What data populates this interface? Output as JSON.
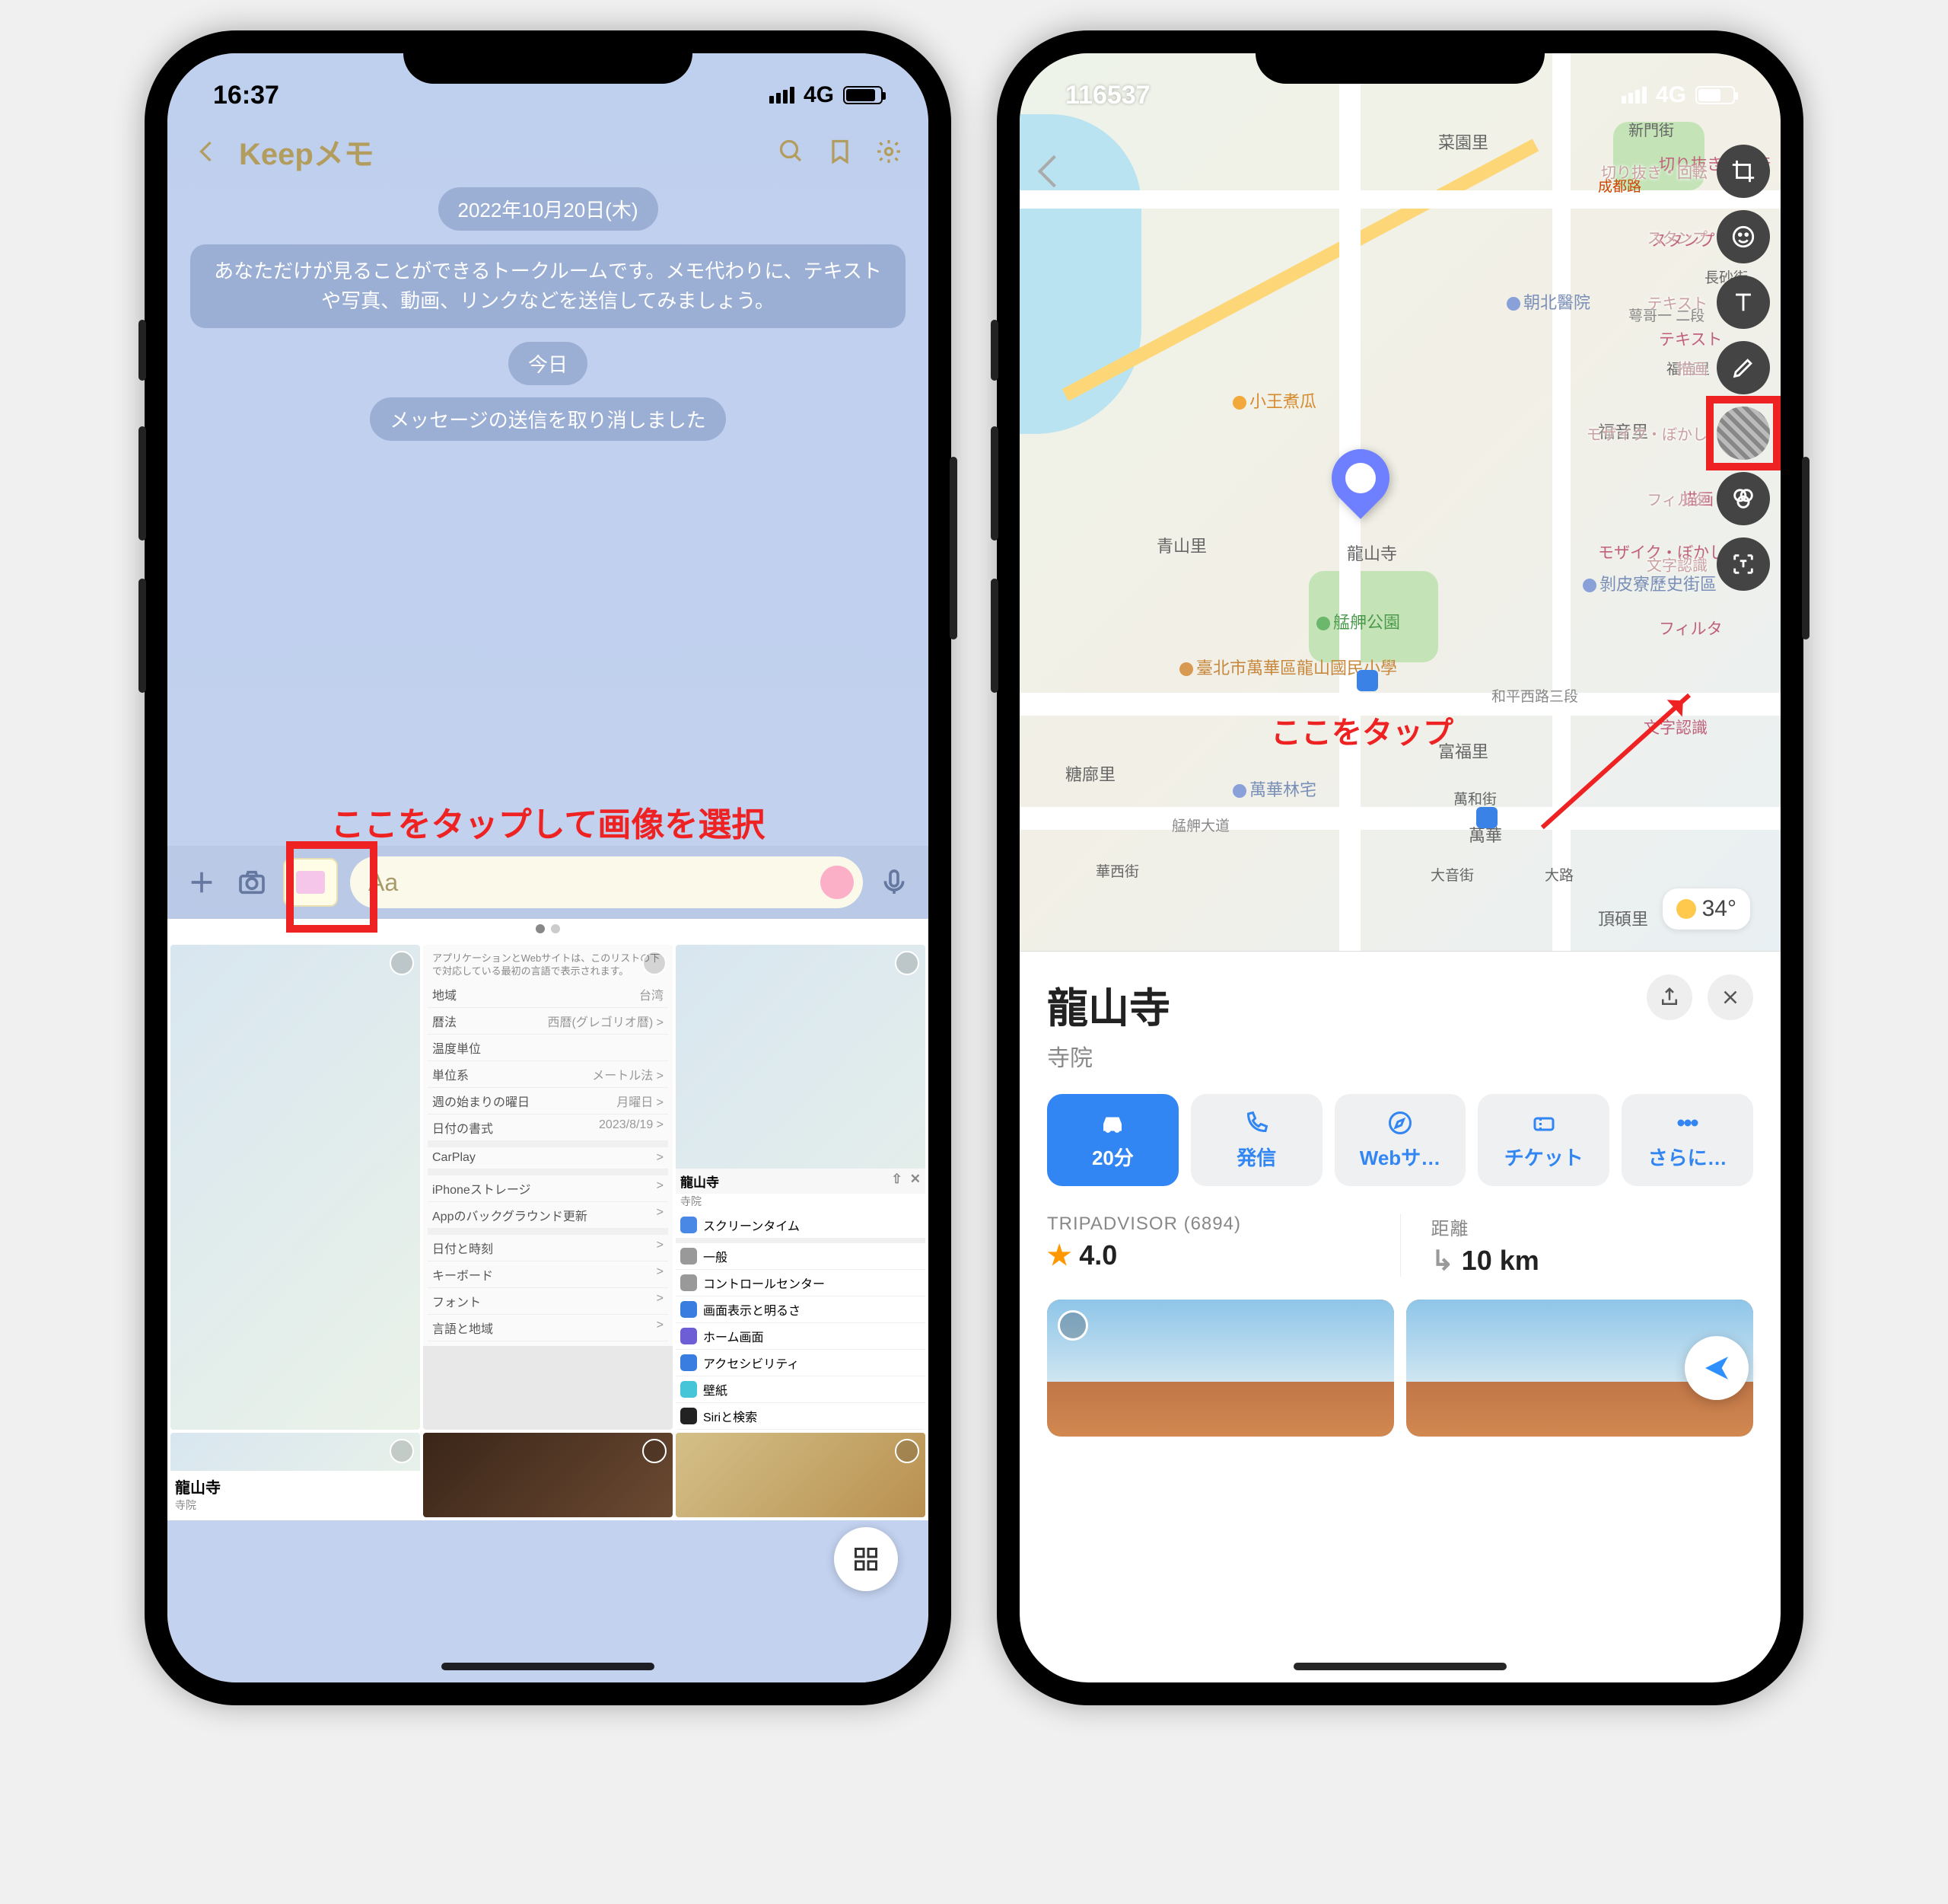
{
  "phone1": {
    "status": {
      "time": "16:37",
      "network": "4G"
    },
    "header": {
      "title": "Keepメモ"
    },
    "messages": {
      "date_pill": "2022年10月20日(木)",
      "intro": "あなただけが見ることができるトークルームです。メモ代わりに、テキストや写真、動画、リンクなどを送信してみましょう。",
      "today_pill": "今日",
      "recall_pill": "メッセージの送信を取り消しました"
    },
    "annotation": "ここをタップして画像を選択",
    "input": {
      "placeholder": "Aa"
    },
    "gallery": {
      "thumbs": [
        {
          "type": "settings",
          "rows": [
            {
              "k": "地域",
              "v": "台湾"
            },
            {
              "k": "暦法",
              "v": "西暦(グレゴリオ暦) >"
            },
            {
              "k": "温度単位",
              "v": ""
            },
            {
              "k": "単位系",
              "v": "メートル法 >"
            },
            {
              "k": "週の始まりの曜日",
              "v": "月曜日 >"
            },
            {
              "k": "日付の書式",
              "v": "2023/8/19 >"
            },
            {
              "k": "CarPlay",
              "v": ">"
            },
            {
              "k": "iPhoneストレージ",
              "v": ">"
            },
            {
              "k": "Appのバックグラウンド更新",
              "v": ">"
            },
            {
              "k": "日付と時刻",
              "v": ">"
            },
            {
              "k": "キーボード",
              "v": ">"
            },
            {
              "k": "フォント",
              "v": ">"
            },
            {
              "k": "言語と地域",
              "v": ">"
            }
          ],
          "note": "アプリケーションとWebサイトは、このリストの下で対応している最初の言語で表示されます。"
        },
        {
          "type": "map_detail",
          "title": "龍山寺",
          "sub": "寺院",
          "icons": [
            "share",
            "close"
          ],
          "list": [
            {
              "ico": "#4a88e6",
              "t": "スクリーンタイム"
            },
            {
              "ico": "#999",
              "t": "一般"
            },
            {
              "ico": "#999",
              "t": "コントロールセンター"
            },
            {
              "ico": "#3a7de0",
              "t": "画面表示と明るさ"
            },
            {
              "ico": "#6d5ed6",
              "t": "ホーム画面"
            },
            {
              "ico": "#3a7de0",
              "t": "アクセシビリティ"
            },
            {
              "ico": "#46c5d8",
              "t": "壁紙"
            },
            {
              "ico": "#e66",
              "t": "Siriと検索"
            }
          ]
        },
        {
          "type": "map_caption",
          "title": "龍山寺",
          "sub": "寺院"
        }
      ]
    }
  },
  "phone2": {
    "status": {
      "time": "116537",
      "network": "4G"
    },
    "map": {
      "labels": [
        "菜園里",
        "新門街",
        "成都路",
        "切り抜き・回転",
        "長砂街",
        "スタンプ",
        "朝北醫院",
        "二段",
        "テキスト",
        "福信里",
        "小王煮瓜",
        "福音里",
        "描画",
        "青山里",
        "龍山寺",
        "モザイク・ぼかし",
        "剝皮寮歷史街區",
        "艋舺公園",
        "フィルタ",
        "臺北市萬華區龍山國民小學",
        "和平西路三段",
        "文字認識",
        "富福里",
        "糖廍里",
        "萬華林宅",
        "萬和街",
        "艋舺大道",
        "萬華",
        "華西街",
        "大音街",
        "大路",
        "頂碩里"
      ],
      "temp": "34°"
    },
    "annotation": "ここをタップ",
    "detail": {
      "title": "龍山寺",
      "subtitle": "寺院",
      "actions": [
        {
          "id": "drive",
          "label": "20分",
          "primary": true
        },
        {
          "id": "call",
          "label": "発信"
        },
        {
          "id": "web",
          "label": "Webサ…"
        },
        {
          "id": "ticket",
          "label": "チケット"
        },
        {
          "id": "more",
          "label": "さらに…"
        }
      ],
      "rating": {
        "label": "TRIPADVISOR (6894)",
        "value": "4.0"
      },
      "distance": {
        "label": "距離",
        "value": "10 km"
      }
    }
  }
}
